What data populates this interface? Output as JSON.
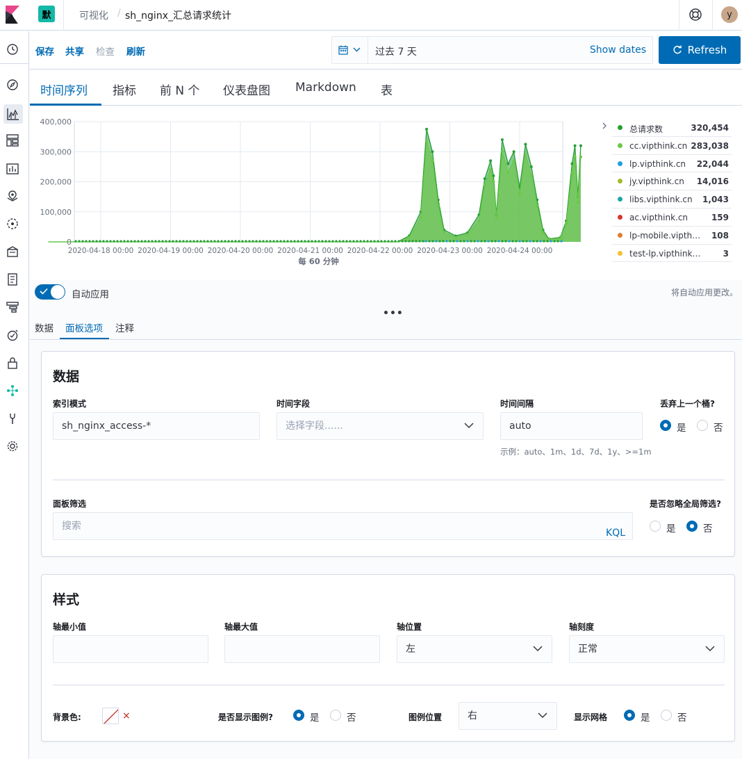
{
  "header": {
    "space_initial": "默",
    "breadcrumb_app": "可视化",
    "breadcrumb_separator": "/",
    "breadcrumb_title": "sh_nginx_汇总请求统计",
    "user_initial": "y"
  },
  "toolbar": {
    "save": "保存",
    "share": "共享",
    "inspect": "检查",
    "refresh_link": "刷新",
    "date_range": "过去 7 天",
    "show_dates": "Show dates",
    "refresh_button": "Refresh"
  },
  "vis_tabs": [
    "时间序列",
    "指标",
    "前 N 个",
    "仪表盘图",
    "Markdown",
    "表"
  ],
  "chart_data": {
    "type": "area",
    "xlabel": "每 60 分钟",
    "ylim": [
      0,
      400000
    ],
    "y_ticks": [
      "400,000",
      "300,000",
      "200,000",
      "100,000",
      "0"
    ],
    "x_ticks": [
      "2020-04-18 00:00",
      "2020-04-19 00:00",
      "2020-04-20 00:00",
      "2020-04-21 00:00",
      "2020-04-22 00:00",
      "2020-04-23 00:00",
      "2020-04-24 00:00"
    ],
    "grid": true,
    "legend_position": "right",
    "series": [
      {
        "name": "总请求数",
        "color": "#279f38",
        "points": [
          [
            "2020-04-17 06:00",
            0
          ],
          [
            "2020-04-22 06:00",
            0
          ],
          [
            "2020-04-22 10:00",
            20000
          ],
          [
            "2020-04-22 14:00",
            100000
          ],
          [
            "2020-04-22 16:00",
            375000
          ],
          [
            "2020-04-22 18:00",
            300000
          ],
          [
            "2020-04-22 20:00",
            140000
          ],
          [
            "2020-04-22 22:00",
            40000
          ],
          [
            "2020-04-23 02:00",
            20000
          ],
          [
            "2020-04-23 06:00",
            30000
          ],
          [
            "2020-04-23 10:00",
            90000
          ],
          [
            "2020-04-23 12:00",
            210000
          ],
          [
            "2020-04-23 14:00",
            270000
          ],
          [
            "2020-04-23 15:00",
            220000
          ],
          [
            "2020-04-23 16:00",
            90000
          ],
          [
            "2020-04-23 18:00",
            340000
          ],
          [
            "2020-04-23 20:00",
            260000
          ],
          [
            "2020-04-23 22:00",
            300000
          ],
          [
            "2020-04-24 00:00",
            180000
          ],
          [
            "2020-04-24 02:00",
            325000
          ],
          [
            "2020-04-24 04:00",
            250000
          ],
          [
            "2020-04-24 06:00",
            140000
          ],
          [
            "2020-04-24 08:00",
            40000
          ],
          [
            "2020-04-24 10:00",
            10000
          ],
          [
            "2020-04-24 14:00",
            15000
          ],
          [
            "2020-04-24 16:00",
            70000
          ],
          [
            "2020-04-24 18:00",
            260000
          ],
          [
            "2020-04-24 19:00",
            320000
          ],
          [
            "2020-04-24 20:00",
            150000
          ],
          [
            "2020-04-24 21:00",
            320000
          ]
        ]
      },
      {
        "name": "cc.vipthink.cn",
        "color": "#6cc748",
        "points": [
          [
            "2020-04-17 06:00",
            0
          ],
          [
            "2020-04-22 06:00",
            0
          ],
          [
            "2020-04-22 10:00",
            15000
          ],
          [
            "2020-04-22 14:00",
            80000
          ],
          [
            "2020-04-22 16:00",
            335000
          ],
          [
            "2020-04-22 18:00",
            270000
          ],
          [
            "2020-04-22 20:00",
            120000
          ],
          [
            "2020-04-22 22:00",
            30000
          ],
          [
            "2020-04-23 02:00",
            15000
          ],
          [
            "2020-04-23 06:00",
            25000
          ],
          [
            "2020-04-23 10:00",
            70000
          ],
          [
            "2020-04-23 12:00",
            190000
          ],
          [
            "2020-04-23 14:00",
            240000
          ],
          [
            "2020-04-23 15:00",
            200000
          ],
          [
            "2020-04-23 16:00",
            80000
          ],
          [
            "2020-04-23 18:00",
            300000
          ],
          [
            "2020-04-23 20:00",
            230000
          ],
          [
            "2020-04-23 22:00",
            270000
          ],
          [
            "2020-04-24 00:00",
            160000
          ],
          [
            "2020-04-24 02:00",
            290000
          ],
          [
            "2020-04-24 04:00",
            220000
          ],
          [
            "2020-04-24 06:00",
            120000
          ],
          [
            "2020-04-24 08:00",
            30000
          ],
          [
            "2020-04-24 10:00",
            8000
          ],
          [
            "2020-04-24 14:00",
            12000
          ],
          [
            "2020-04-24 16:00",
            60000
          ],
          [
            "2020-04-24 18:00",
            230000
          ],
          [
            "2020-04-24 19:00",
            285000
          ],
          [
            "2020-04-24 20:00",
            130000
          ],
          [
            "2020-04-24 21:00",
            283000
          ]
        ]
      }
    ]
  },
  "legend": [
    {
      "name": "总请求数",
      "value": "320,454",
      "color": "#23a22f"
    },
    {
      "name": "cc.vipthink.cn",
      "value": "283,038",
      "color": "#6cc748"
    },
    {
      "name": "lp.vipthink.cn",
      "value": "22,044",
      "color": "#1ea0dc"
    },
    {
      "name": "jy.vipthink.cn",
      "value": "14,016",
      "color": "#a7b82d"
    },
    {
      "name": "libs.vipthink.cn",
      "value": "1,043",
      "color": "#1ba6a8"
    },
    {
      "name": "ac.vipthink.cn",
      "value": "159",
      "color": "#d5372d"
    },
    {
      "name": "lp-mobile.vipthink.cn",
      "value": "108",
      "color": "#e07d2e"
    },
    {
      "name": "test-lp.vipthink.cn",
      "value": "3",
      "color": "#f1c232"
    }
  ],
  "auto_apply": {
    "label": "自动应用",
    "hint": "将自动应用更改。",
    "handle": "•••"
  },
  "sub_tabs": [
    "数据",
    "面板选项",
    "注释"
  ],
  "data_panel": {
    "title": "数据",
    "index_label": "索引模式",
    "index_value": "sh_nginx_access-*",
    "time_field_label": "时间字段",
    "time_field_placeholder": "选择字段......",
    "interval_label": "时间间隔",
    "interval_value": "auto",
    "interval_hint": "示例：auto、1m、1d、7d、1y、>=1m",
    "drop_last_label": "丢弃上一个桶?",
    "yes": "是",
    "no": "否",
    "filter_label": "面板筛选",
    "filter_placeholder": "搜索",
    "kql": "KQL",
    "ignore_global_label": "是否忽略全局筛选?"
  },
  "style_panel": {
    "title": "样式",
    "axis_min_label": "轴最小值",
    "axis_max_label": "轴最大值",
    "axis_position_label": "轴位置",
    "axis_position_value": "左",
    "axis_scale_label": "轴刻度",
    "axis_scale_value": "正常",
    "bg_color_label": "背景色:",
    "clear": "×",
    "show_legend_label": "是否显示图例?",
    "legend_position_label": "图例位置",
    "legend_position_value": "右",
    "show_grid_label": "显示网格",
    "yes": "是",
    "no": "否"
  }
}
